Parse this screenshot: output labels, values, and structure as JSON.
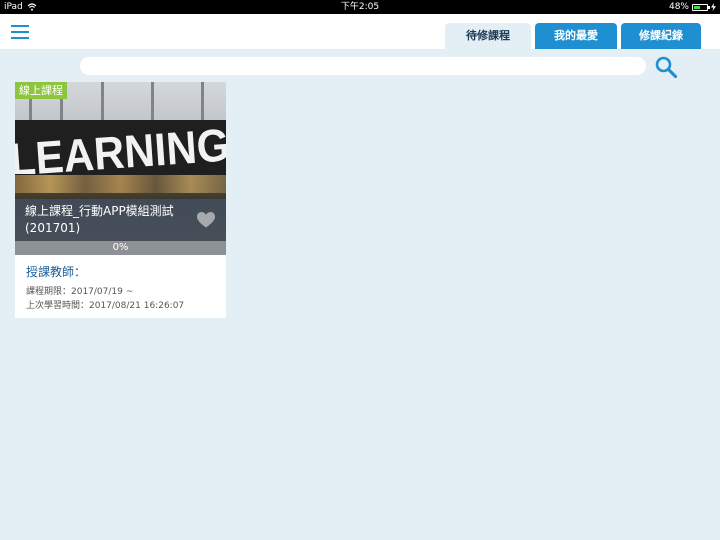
{
  "status_bar": {
    "device": "iPad",
    "time": "下午2:05",
    "battery_text": "48%",
    "battery_level": 0.48
  },
  "header": {
    "tabs": [
      {
        "label": "待修課程"
      },
      {
        "label": "我的最愛"
      },
      {
        "label": "修課紀錄"
      }
    ]
  },
  "search": {
    "value": "",
    "placeholder": ""
  },
  "courses": [
    {
      "category": "線上課程",
      "image_text": "LEARNING",
      "title": "線上課程_行動APP模組測試(201701)",
      "progress_text": "0%",
      "progress": 0,
      "teacher_label": "授課教師：",
      "period": "課程期限：2017/07/19 ~",
      "last_study": "上次學習時間：2017/08/21 16:26:07"
    }
  ],
  "colors": {
    "accent": "#1e90d2",
    "background": "#e4eff5",
    "badge": "#8cc63f",
    "title_overlay": "#434e5c",
    "progress_track": "#8d9195"
  },
  "icons": [
    "menu-icon",
    "wifi-icon",
    "battery-icon",
    "search-icon",
    "heart-icon"
  ]
}
